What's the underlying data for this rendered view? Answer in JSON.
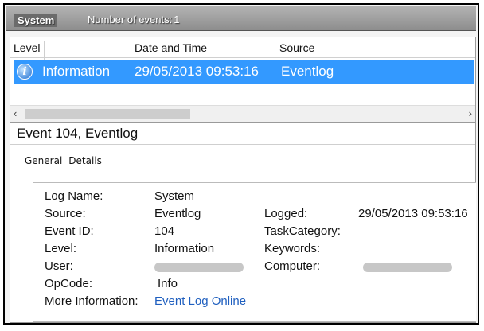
{
  "header": {
    "log_name": "System",
    "events_label": "Number of events:",
    "events_count": "1"
  },
  "list": {
    "columns": {
      "level": "Level",
      "date_time": "Date and Time",
      "source": "Source"
    },
    "rows": [
      {
        "level": "Information",
        "date_time": "29/05/2013 09:53:16",
        "source": "Eventlog"
      }
    ],
    "scroll_left": "‹",
    "scroll_right": "›"
  },
  "detail": {
    "title": "Event 104, Eventlog",
    "tabs": {
      "general": "General",
      "details": "Details"
    },
    "labels": {
      "log_name": "Log Name:",
      "source": "Source:",
      "event_id": "Event ID:",
      "level": "Level:",
      "user": "User:",
      "opcode": "OpCode:",
      "more_info": "More Information:",
      "logged": "Logged:",
      "task_category": "TaskCategory:",
      "keywords": "Keywords:",
      "computer": "Computer:"
    },
    "values": {
      "log_name": "System",
      "source": "Eventlog",
      "event_id": "104",
      "level": "Information",
      "opcode": "Info",
      "more_info_link": "Event Log Online",
      "logged": "29/05/2013 09:53:16"
    }
  },
  "colors": {
    "selection": "#3399ff",
    "link": "#1f5fbf"
  },
  "icons": {
    "row_level": "information-icon"
  }
}
